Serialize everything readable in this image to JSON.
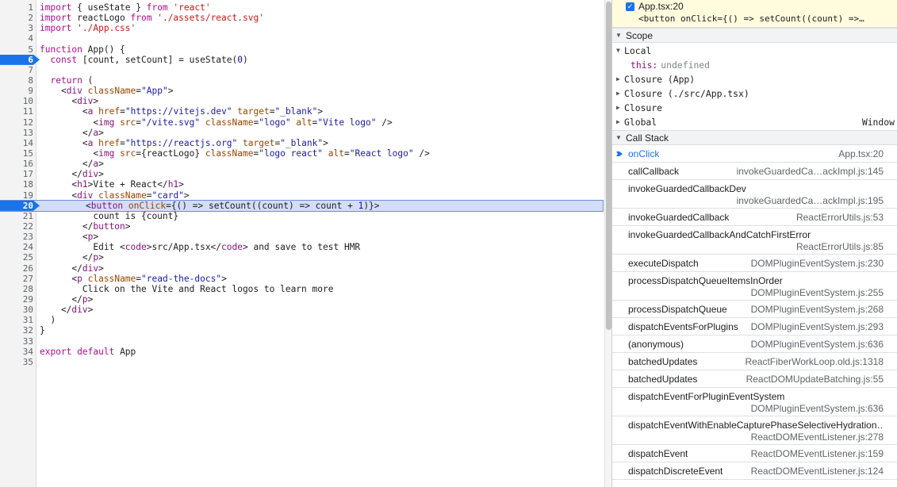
{
  "editor": {
    "lines": [
      {
        "n": "1",
        "html": "<span class=\"kw\">import</span> { useState } <span class=\"kw\">from</span> <span class=\"str\">'react'</span>"
      },
      {
        "n": "2",
        "html": "<span class=\"kw\">import</span> reactLogo <span class=\"kw\">from</span> <span class=\"str\">'./assets/react.svg'</span>"
      },
      {
        "n": "3",
        "html": "<span class=\"kw\">import</span> <span class=\"str\">'./App.css'</span>"
      },
      {
        "n": "4",
        "html": ""
      },
      {
        "n": "5",
        "html": "<span class=\"kw\">function</span> App() {"
      },
      {
        "n": "6",
        "html": "  <span class=\"kw\">const</span> [count, setCount] = useState(<span class=\"num\">0</span>)",
        "bp": true
      },
      {
        "n": "7",
        "html": ""
      },
      {
        "n": "8",
        "html": "  <span class=\"kw\">return</span> ("
      },
      {
        "n": "9",
        "html": "    &lt;<span class=\"tag\">div</span> <span class=\"attr\">className</span>=<span class=\"av\">\"App\"</span>&gt;"
      },
      {
        "n": "10",
        "html": "      &lt;<span class=\"tag\">div</span>&gt;"
      },
      {
        "n": "11",
        "html": "        &lt;<span class=\"tag\">a</span> <span class=\"attr\">href</span>=<span class=\"av\">\"https://vitejs.dev\"</span> <span class=\"attr\">target</span>=<span class=\"av\">\"_blank\"</span>&gt;"
      },
      {
        "n": "12",
        "html": "          &lt;<span class=\"tag\">img</span> <span class=\"attr\">src</span>=<span class=\"av\">\"/vite.svg\"</span> <span class=\"attr\">className</span>=<span class=\"av\">\"logo\"</span> <span class=\"attr\">alt</span>=<span class=\"av\">\"Vite logo\"</span> /&gt;"
      },
      {
        "n": "13",
        "html": "        &lt;/<span class=\"tag\">a</span>&gt;"
      },
      {
        "n": "14",
        "html": "        &lt;<span class=\"tag\">a</span> <span class=\"attr\">href</span>=<span class=\"av\">\"https://reactjs.org\"</span> <span class=\"attr\">target</span>=<span class=\"av\">\"_blank\"</span>&gt;"
      },
      {
        "n": "15",
        "html": "          &lt;<span class=\"tag\">img</span> <span class=\"attr\">src</span>={reactLogo} <span class=\"attr\">className</span>=<span class=\"av\">\"logo react\"</span> <span class=\"attr\">alt</span>=<span class=\"av\">\"React logo\"</span> /&gt;"
      },
      {
        "n": "16",
        "html": "        &lt;/<span class=\"tag\">a</span>&gt;"
      },
      {
        "n": "17",
        "html": "      &lt;/<span class=\"tag\">div</span>&gt;"
      },
      {
        "n": "18",
        "html": "      &lt;<span class=\"tag\">h1</span>&gt;Vite + React&lt;/<span class=\"tag\">h1</span>&gt;"
      },
      {
        "n": "19",
        "html": "      &lt;<span class=\"tag\">div</span> <span class=\"attr\">className</span>=<span class=\"av\">\"card\"</span>&gt;"
      },
      {
        "n": "20",
        "html": "&lt;<span class=\"tag\">button</span> <span class=\"attr\">onClick</span>={() =&gt; setCount((count) =&gt; count + <span class=\"num\">1</span>)}&gt;",
        "bp": true,
        "exec": true
      },
      {
        "n": "21",
        "html": "          count is {count}"
      },
      {
        "n": "22",
        "html": "        &lt;/<span class=\"tag\">button</span>&gt;"
      },
      {
        "n": "23",
        "html": "        &lt;<span class=\"tag\">p</span>&gt;"
      },
      {
        "n": "24",
        "html": "          Edit &lt;<span class=\"tag\">code</span>&gt;src/App.tsx&lt;/<span class=\"tag\">code</span>&gt; and save to test HMR"
      },
      {
        "n": "25",
        "html": "        &lt;/<span class=\"tag\">p</span>&gt;"
      },
      {
        "n": "26",
        "html": "      &lt;/<span class=\"tag\">div</span>&gt;"
      },
      {
        "n": "27",
        "html": "      &lt;<span class=\"tag\">p</span> <span class=\"attr\">className</span>=<span class=\"av\">\"read-the-docs\"</span>&gt;"
      },
      {
        "n": "28",
        "html": "        Click on the Vite and React logos to learn more"
      },
      {
        "n": "29",
        "html": "      &lt;/<span class=\"tag\">p</span>&gt;"
      },
      {
        "n": "30",
        "html": "    &lt;/<span class=\"tag\">div</span>&gt;"
      },
      {
        "n": "31",
        "html": "  )"
      },
      {
        "n": "32",
        "html": "}"
      },
      {
        "n": "33",
        "html": ""
      },
      {
        "n": "34",
        "html": "<span class=\"kw\">export</span> <span class=\"kw\">default</span> App"
      },
      {
        "n": "35",
        "html": ""
      }
    ]
  },
  "breakpoints": {
    "file": "App.tsx:20",
    "code": "<button onClick={() => setCount((count) =>…"
  },
  "scope": {
    "title": "Scope",
    "local_label": "Local",
    "this_key": "this:",
    "this_value": "undefined",
    "closure_app": "Closure (App)",
    "closure_src": "Closure (./src/App.tsx)",
    "closure": "Closure",
    "global": "Global",
    "global_value": "Window"
  },
  "call_stack": {
    "title": "Call Stack",
    "frames": [
      {
        "fn": "onClick",
        "loc": "App.tsx:20",
        "current": true
      },
      {
        "fn": "callCallback",
        "loc": "invokeGuardedCa…ackImpl.js:145"
      },
      {
        "fn": "invokeGuardedCallbackDev",
        "loc": "invokeGuardedCa…ackImpl.js:195",
        "two": true
      },
      {
        "fn": "invokeGuardedCallback",
        "loc": "ReactErrorUtils.js:53"
      },
      {
        "fn": "invokeGuardedCallbackAndCatchFirstError",
        "loc": "ReactErrorUtils.js:85",
        "two": true
      },
      {
        "fn": "executeDispatch",
        "loc": "DOMPluginEventSystem.js:230"
      },
      {
        "fn": "processDispatchQueueItemsInOrder",
        "loc": "DOMPluginEventSystem.js:255",
        "two": true
      },
      {
        "fn": "processDispatchQueue",
        "loc": "DOMPluginEventSystem.js:268"
      },
      {
        "fn": "dispatchEventsForPlugins",
        "loc": "DOMPluginEventSystem.js:293"
      },
      {
        "fn": "(anonymous)",
        "loc": "DOMPluginEventSystem.js:636"
      },
      {
        "fn": "batchedUpdates",
        "loc": "ReactFiberWorkLoop.old.js:1318"
      },
      {
        "fn": "batchedUpdates",
        "loc": "ReactDOMUpdateBatching.js:55"
      },
      {
        "fn": "dispatchEventForPluginEventSystem",
        "loc": "DOMPluginEventSystem.js:636",
        "two": true
      },
      {
        "fn": "dispatchEventWithEnableCapturePhaseSelectiveHydration…",
        "loc": "ReactDOMEventListener.js:278",
        "two": true
      },
      {
        "fn": "dispatchEvent",
        "loc": "ReactDOMEventListener.js:159"
      },
      {
        "fn": "dispatchDiscreteEvent",
        "loc": "ReactDOMEventListener.js:124"
      }
    ]
  },
  "colors": {
    "accent": "#1a73e8",
    "exec_line": "#d4ddf7",
    "breakpoint_bg": "#fffbdd"
  }
}
